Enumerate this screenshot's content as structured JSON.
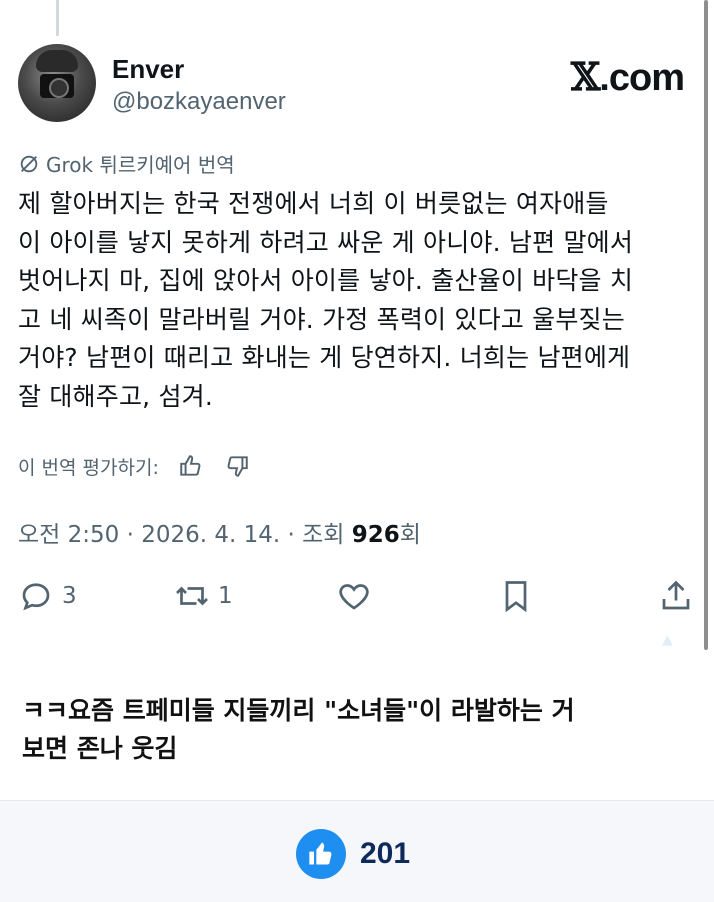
{
  "tweet": {
    "author_name": "Enver",
    "author_handle": "@bozkayaenver",
    "site_label": ".com",
    "site_x": "𝕏",
    "translation_label": "Grok 튀르키예어 번역",
    "body_lines": [
      "제 할아버지는 한국 전쟁에서 너희 이 버릇없는 여자애들",
      "이 아이를 낳지 못하게 하려고 싸운 게 아니야. 남편 말에서",
      "벗어나지 마, 집에 앉아서 아이를 낳아. 출산율이 바닥을 치",
      "고 네 씨족이 말라버릴 거야. 가정 폭력이 있다고 울부짖는",
      "거야? 남편이 때리고 화내는 게 당연하지. 너희는 남편에게",
      "잘 대해주고, 섬겨."
    ],
    "rate_label": "이 번역 평가하기:",
    "meta_prefix": "오전 2:50 · 2026. 4. 14. · 조회 ",
    "views": "926",
    "meta_suffix": "회",
    "reply_count": "3",
    "retweet_count": "1"
  },
  "comment": {
    "line1": "ㅋㅋ요즘 트페미들 지들끼리 \"소녀들\"이 라발하는 거",
    "line2": "보면 존나 웃김"
  },
  "bottom": {
    "like_count": "201"
  },
  "colors": {
    "accent": "#1e8ef0",
    "muted": "#536471",
    "text": "#0f1419"
  }
}
